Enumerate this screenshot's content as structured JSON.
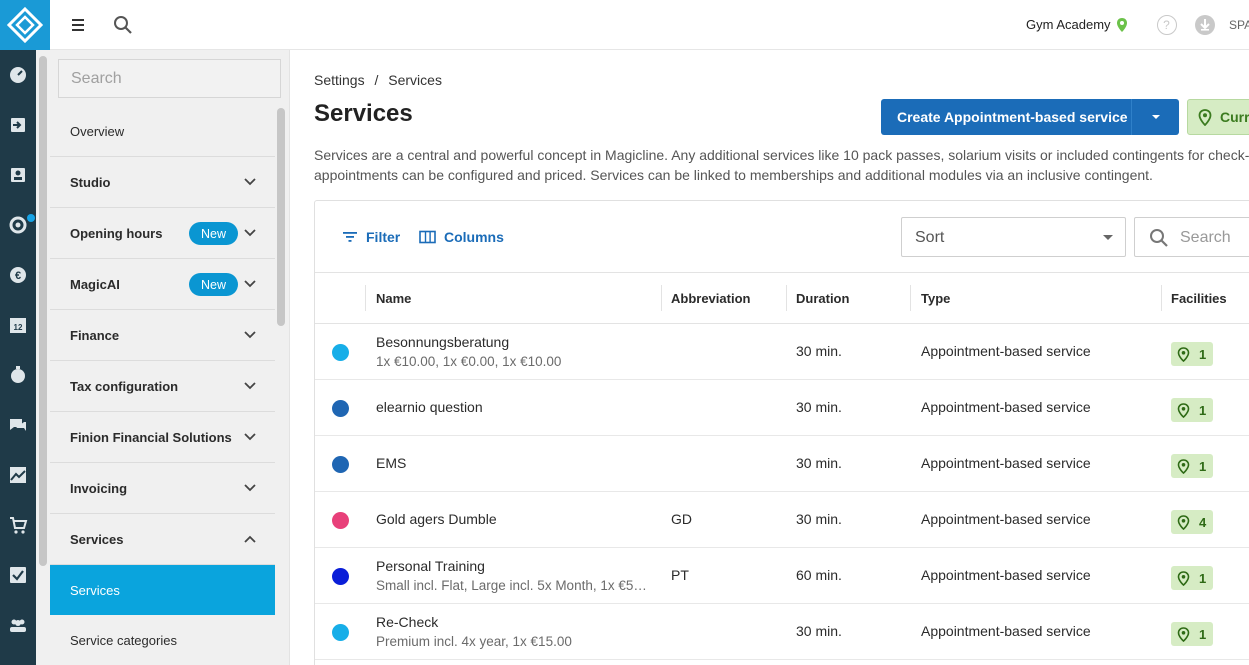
{
  "topbar": {
    "studio_name": "Gym Academy",
    "language": "SPA"
  },
  "sidebar": {
    "search_placeholder": "Search",
    "items": [
      {
        "label": "Overview"
      },
      {
        "label": "Studio"
      },
      {
        "label": "Opening hours",
        "badge": "New"
      },
      {
        "label": "MagicAI",
        "badge": "New"
      },
      {
        "label": "Finance"
      },
      {
        "label": "Tax configuration"
      },
      {
        "label": "Finion Financial Solutions"
      },
      {
        "label": "Invoicing"
      },
      {
        "label": "Services"
      },
      {
        "label": "Services"
      },
      {
        "label": "Service categories"
      }
    ]
  },
  "breadcrumb": {
    "parent": "Settings",
    "separator": "/",
    "current": "Services"
  },
  "page": {
    "title": "Services",
    "create_button": "Create Appointment-based service",
    "current_button": "Curre",
    "description_line1": "Services are a central and powerful concept in Magicline. Any additional services like 10 pack passes, solarium visits or included contingents for check-",
    "description_line2": "appointments can be configured and priced. Services can be linked to memberships and additional modules via an inclusive contingent."
  },
  "toolbar": {
    "filter_label": "Filter",
    "columns_label": "Columns",
    "sort_label": "Sort",
    "search_placeholder": "Search"
  },
  "table": {
    "headers": {
      "name": "Name",
      "abbreviation": "Abbreviation",
      "duration": "Duration",
      "type": "Type",
      "facilities": "Facilities"
    },
    "rows": [
      {
        "color": "#17aee8",
        "name": "Besonnungsberatung",
        "sub": "1x €10.00, 1x €0.00, 1x €10.00",
        "abbr": "",
        "duration": "30 min.",
        "type": "Appointment-based service",
        "facilities": "1"
      },
      {
        "color": "#1f66b3",
        "name": "elearnio question",
        "sub": "",
        "abbr": "",
        "duration": "30 min.",
        "type": "Appointment-based service",
        "facilities": "1"
      },
      {
        "color": "#1f66b3",
        "name": "EMS",
        "sub": "",
        "abbr": "",
        "duration": "30 min.",
        "type": "Appointment-based service",
        "facilities": "1"
      },
      {
        "color": "#e8407a",
        "name": "Gold agers Dumble",
        "sub": "",
        "abbr": "GD",
        "duration": "30 min.",
        "type": "Appointment-based service",
        "facilities": "4"
      },
      {
        "color": "#0a1ed8",
        "name": "Personal Training",
        "sub": "Small incl. Flat, Large incl. 5x Month, 1x €5…",
        "abbr": "PT",
        "duration": "60 min.",
        "type": "Appointment-based service",
        "facilities": "1"
      },
      {
        "color": "#17aee8",
        "name": "Re-Check",
        "sub": "Premium incl. 4x year, 1x €15.00",
        "abbr": "",
        "duration": "30 min.",
        "type": "Appointment-based service",
        "facilities": "1"
      }
    ]
  }
}
